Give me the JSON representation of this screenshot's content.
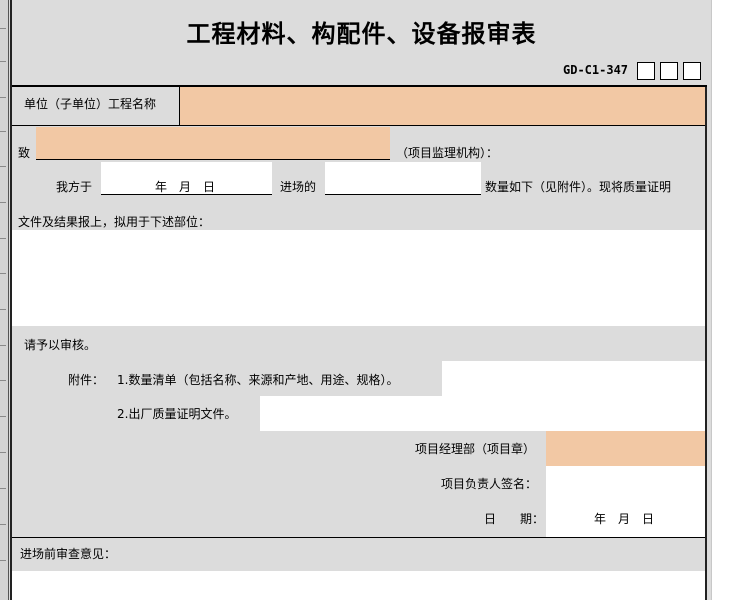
{
  "form": {
    "title": "工程材料、构配件、设备报审表",
    "code": "GD-C1-347",
    "unit_label": "单位（子单位）工程名称",
    "to_label": "致",
    "supervisor_label": "（项目监理机构）：",
    "we_label": "我方于",
    "date_ymd": "年　月　日",
    "enter_label": "进场的",
    "quantity_text": "数量如下（见附件）。现将质量证明",
    "docs_text": "文件及结果报上，拟用于下述部位：",
    "review_request": "请予以审核。",
    "attach_label": "附件：",
    "attach_1": "1.数量清单（包括名称、来源和产地、用途、规格）。",
    "attach_2": "2.出厂质量证明文件。",
    "dept_label": "项目经理部（项目章）",
    "sign_label": "项目负责人签名：",
    "date_label": "日　　期：",
    "date_value": "年　月　日",
    "pre_review_label": "进场前审查意见："
  },
  "colors": {
    "peach": "#f2c8a4",
    "grey": "#dcdcdc",
    "white": "#ffffff"
  }
}
